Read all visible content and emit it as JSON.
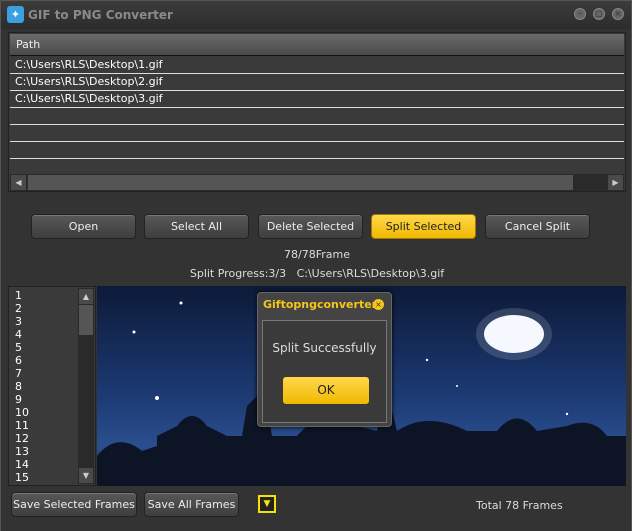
{
  "window": {
    "title": "GIF to PNG Converter",
    "icon": "app-icon",
    "controls": [
      "minimize",
      "restore",
      "close"
    ]
  },
  "file_list": {
    "header": "Path",
    "rows": [
      "C:\\Users\\RLS\\Desktop\\1.gif",
      "C:\\Users\\RLS\\Desktop\\2.gif",
      "C:\\Users\\RLS\\Desktop\\3.gif",
      "",
      "",
      "",
      ""
    ]
  },
  "buttons": {
    "open": "Open",
    "select_all": "Select All",
    "delete_selected": "Delete Selected",
    "split_selected": "Split Selected",
    "cancel_split": "Cancel Split"
  },
  "status": {
    "frame": "78/78Frame",
    "progress": "Split Progress:3/3   C:\\Users\\RLS\\Desktop\\3.gif"
  },
  "frames": [
    "1",
    "2",
    "3",
    "4",
    "5",
    "6",
    "7",
    "8",
    "9",
    "10",
    "11",
    "12",
    "13",
    "14",
    "15"
  ],
  "dialog": {
    "title": "Giftopngconverter",
    "message": "Split Successfully",
    "ok": "OK"
  },
  "bottom": {
    "save_selected": "Save Selected Frames",
    "save_all": "Save All Frames",
    "total": "Total 78 Frames"
  },
  "colors": {
    "accent": "#f5c518",
    "background": "#333333"
  }
}
